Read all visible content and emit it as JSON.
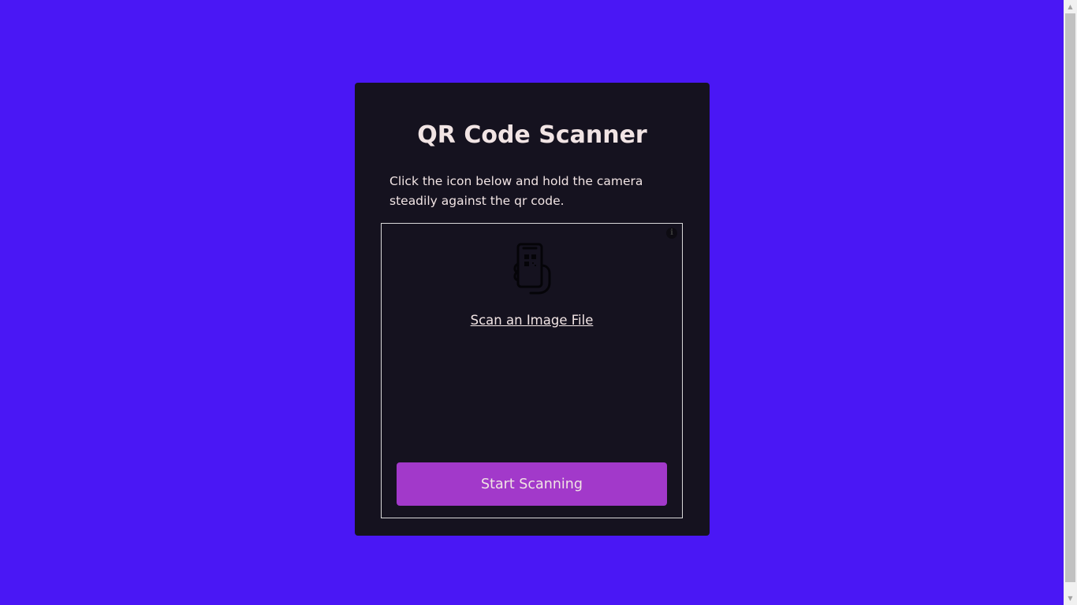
{
  "page": {
    "title": "QR Code Scanner",
    "instructions": "Click the icon below and hold the camera steadily against the qr code.",
    "scanner": {
      "info_icon_label": "i",
      "scan_file_link": "Scan an Image File",
      "start_button_label": "Start Scanning"
    }
  },
  "icons": {
    "phone": "phone-scan-icon",
    "info": "info-icon"
  },
  "colors": {
    "background": "#4a17f5",
    "card": "#15121f",
    "text": "#f1e4e4",
    "button": "#a239ca",
    "region_border": "#d9d9d9"
  },
  "scrollbar": {
    "up_arrow": "▲",
    "down_arrow": "▼"
  }
}
